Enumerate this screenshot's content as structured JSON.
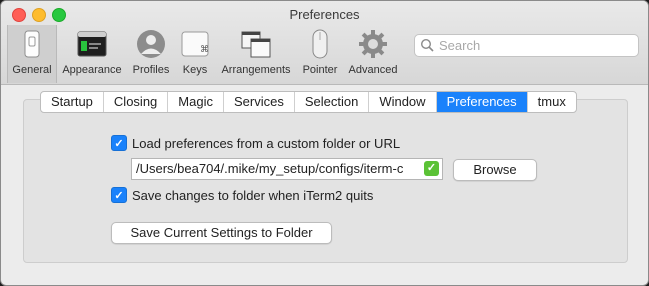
{
  "window": {
    "title": "Preferences"
  },
  "toolbar": {
    "items": [
      {
        "label": "General",
        "icon": "general-switch-icon",
        "selected": true
      },
      {
        "label": "Appearance",
        "icon": "terminal-window-icon",
        "selected": false
      },
      {
        "label": "Profiles",
        "icon": "profile-avatar-icon",
        "selected": false
      },
      {
        "label": "Keys",
        "icon": "command-key-icon",
        "selected": false
      },
      {
        "label": "Arrangements",
        "icon": "window-arrangement-icon",
        "selected": false
      },
      {
        "label": "Pointer",
        "icon": "mouse-pointer-icon",
        "selected": false
      },
      {
        "label": "Advanced",
        "icon": "gear-icon",
        "selected": false
      }
    ],
    "search_placeholder": "Search"
  },
  "tabs": [
    {
      "label": "Startup",
      "active": false
    },
    {
      "label": "Closing",
      "active": false
    },
    {
      "label": "Magic",
      "active": false
    },
    {
      "label": "Services",
      "active": false
    },
    {
      "label": "Selection",
      "active": false
    },
    {
      "label": "Window",
      "active": false
    },
    {
      "label": "Preferences",
      "active": true
    },
    {
      "label": "tmux",
      "active": false
    }
  ],
  "preferences": {
    "load_custom_label": "Load preferences from a custom folder or URL",
    "load_custom_checked": true,
    "path_value": "/Users/bea704/.mike/my_setup/configs/iterm-c",
    "browse_label": "Browse",
    "save_changes_label": "Save changes to folder when iTerm2 quits",
    "save_changes_checked": true,
    "save_current_label": "Save Current Settings to Folder"
  },
  "colors": {
    "accent": "#1a82fb",
    "valid": "#5bc236"
  }
}
